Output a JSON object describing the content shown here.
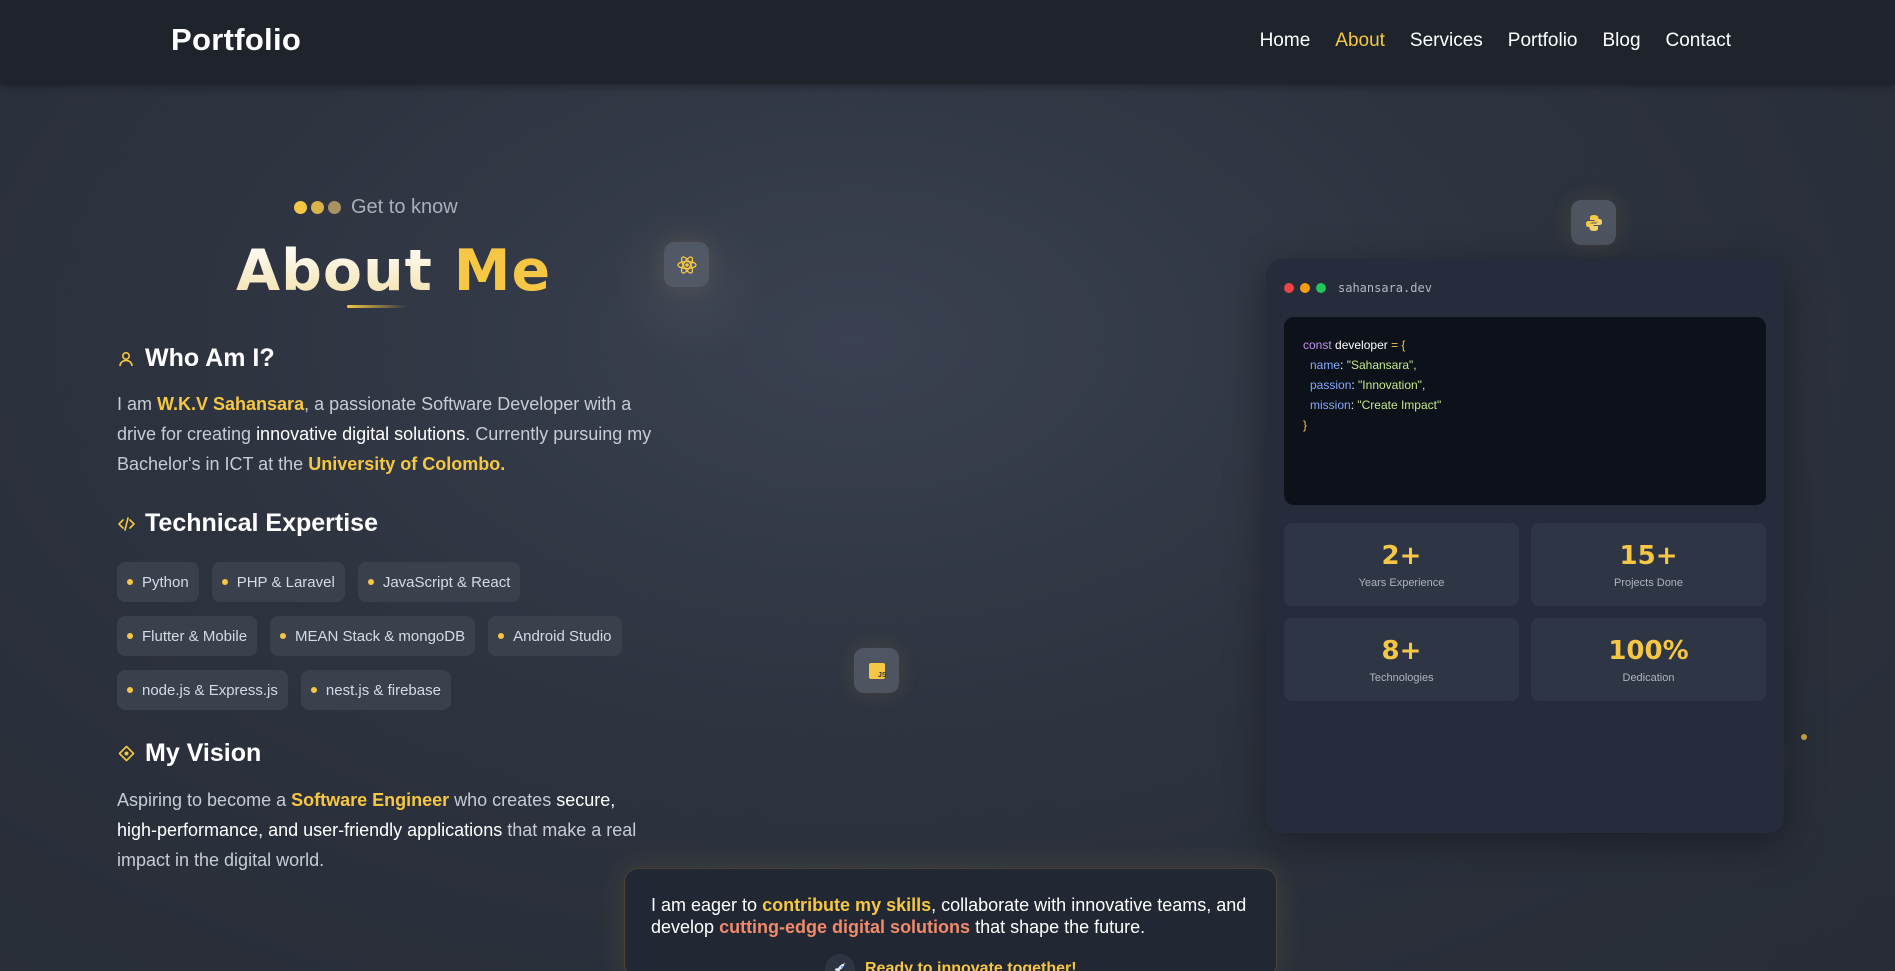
{
  "nav": {
    "logo": "Portfolio",
    "links": [
      "Home",
      "About",
      "Services",
      "Portfolio",
      "Blog",
      "Contact"
    ],
    "active": "About"
  },
  "hero": {
    "kicker": "Get to know",
    "title_part1": "About",
    "title_part2": "Me"
  },
  "who": {
    "heading": "Who Am I?",
    "p1": "I am ",
    "name": "W.K.V Sahansara",
    "p2": ", a passionate Software Developer with a drive for creating ",
    "em1": "innovative digital solutions",
    "p3": ". Currently pursuing my Bachelor's in ICT at the ",
    "uni": "University of Colombo."
  },
  "expertise": {
    "heading": "Technical Expertise",
    "rows": [
      [
        "Python",
        "PHP & Laravel",
        "JavaScript & React"
      ],
      [
        "Flutter & Mobile",
        "MEAN Stack & mongoDB",
        "Android Studio"
      ],
      [
        "node.js & Express.js",
        "nest.js & firebase"
      ]
    ]
  },
  "vision": {
    "heading": "My Vision",
    "p1": "Aspiring to become a ",
    "role": "Software Engineer",
    "p2": " who creates ",
    "em1": "secure, high-performance, and user-friendly applications",
    "p3": " that make a real impact in the digital world."
  },
  "card": {
    "domain": "sahansara.dev",
    "code": {
      "kw": "const",
      "var": "developer",
      "eq": " = {",
      "lines": [
        {
          "prop": "name",
          "value": "\"Sahansara\","
        },
        {
          "prop": "passion",
          "value": "\"Innovation\","
        },
        {
          "prop": "mission",
          "value": "\"Create Impact\""
        }
      ],
      "close": "}"
    },
    "stats": [
      {
        "value": "2+",
        "label": "Years Experience"
      },
      {
        "value": "15+",
        "label": "Projects Done"
      },
      {
        "value": "8+",
        "label": "Technologies"
      },
      {
        "value": "100%",
        "label": "Dedication"
      }
    ]
  },
  "callout": {
    "t1": "I am eager to ",
    "a": "contribute my skills",
    "t2": ", collaborate with innovative teams, and develop ",
    "b": "cutting-edge digital solutions",
    "t3": " that shape the future.",
    "cta": "Ready to innovate together!"
  },
  "colors": {
    "accent": "#f6c744",
    "accent2": "#f08a6a",
    "nav_bg": "#1e232c",
    "card_bg": "#262c3b"
  },
  "icons": [
    "user-icon",
    "code-icon",
    "target-icon",
    "react-icon",
    "python-icon",
    "js-icon",
    "rocket-icon"
  ]
}
